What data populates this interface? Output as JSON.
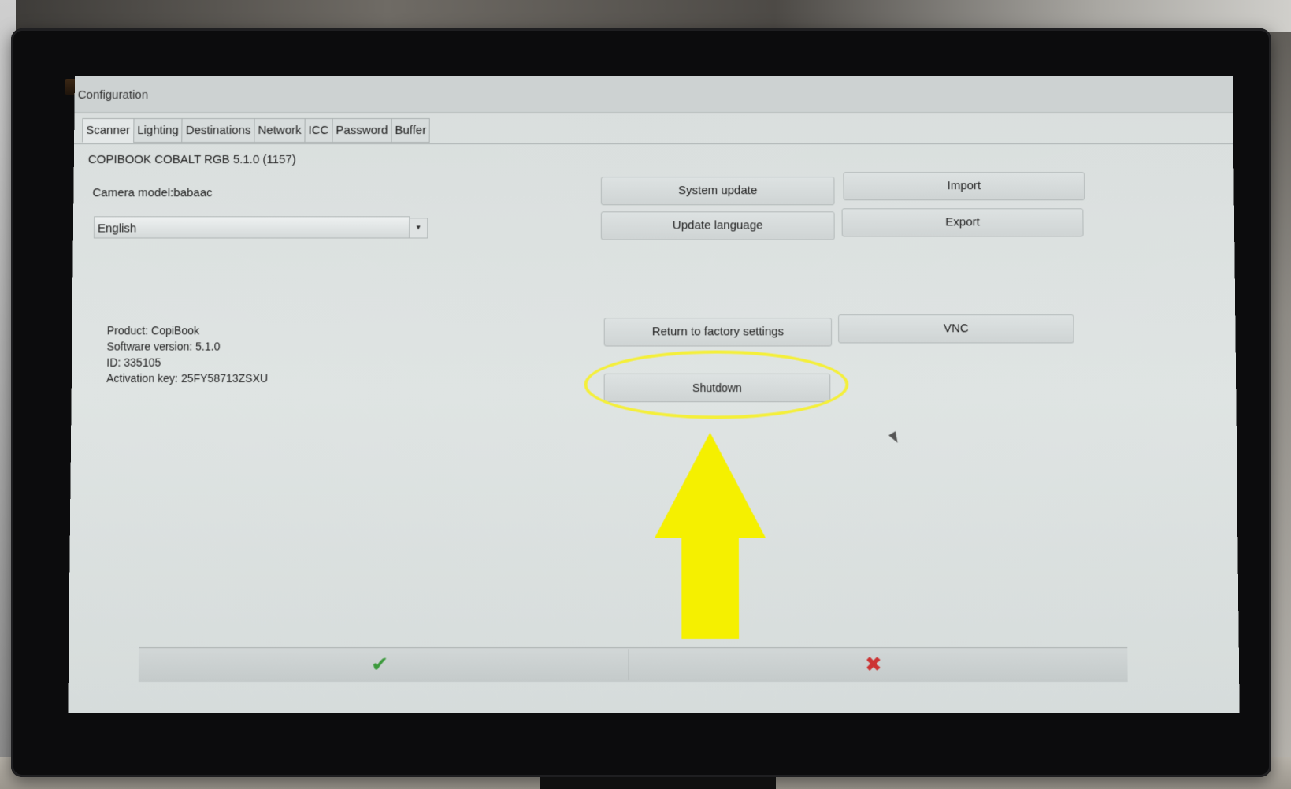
{
  "window": {
    "title": "Configuration"
  },
  "tabs": [
    {
      "label": "Scanner",
      "active": true
    },
    {
      "label": "Lighting"
    },
    {
      "label": "Destinations"
    },
    {
      "label": "Network"
    },
    {
      "label": "ICC"
    },
    {
      "label": "Password"
    },
    {
      "label": "Buffer"
    }
  ],
  "scanner": {
    "product_line": "COPIBOOK COBALT RGB 5.1.0 (1157)",
    "camera_model": "Camera model:babaac",
    "language": {
      "selected": "English",
      "arrow_icon": "dropdown-arrow-icon"
    },
    "info": {
      "product": "Product: CopiBook",
      "software_version": "Software version: 5.1.0",
      "id": "ID: 335105",
      "activation_key": "Activation key: 25FY58713ZSXU"
    }
  },
  "buttons": {
    "system_update": "System update",
    "import": "Import",
    "update_language": "Update language",
    "export": "Export",
    "factory_settings": "Return to factory settings",
    "vnc": "VNC",
    "shutdown": "Shutdown"
  },
  "bottom": {
    "ok_icon": "checkmark-icon",
    "cancel_icon": "cross-icon",
    "ok_glyph": "✔",
    "cancel_glyph": "✖"
  },
  "annotation": {
    "highlight_color": "#f4ef3a",
    "arrow_color": "#f5f000"
  }
}
